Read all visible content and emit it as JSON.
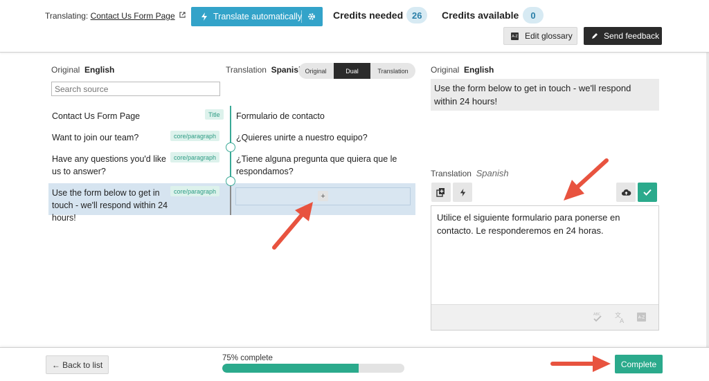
{
  "header": {
    "translating_label": "Translating:",
    "page_name": "Contact Us Form Page",
    "translate_button": "Translate automatically",
    "credits_needed_label": "Credits needed",
    "credits_needed_value": "26",
    "credits_available_label": "Credits available",
    "credits_available_value": "0",
    "edit_glossary": "Edit glossary",
    "send_feedback": "Send feedback"
  },
  "left_panel": {
    "original_label": "Original",
    "original_lang": "English",
    "translation_label": "Translation",
    "translation_lang": "Spanish",
    "search_placeholder": "Search source",
    "view_toggle": [
      "Original",
      "Dual",
      "Translation"
    ],
    "active_view": "Dual",
    "rows": [
      {
        "source": "Contact Us Form Page",
        "tag": "Title",
        "translation": "Formulario de contacto"
      },
      {
        "source": "Want to join our team?",
        "tag": "core/paragraph",
        "translation": "¿Quieres unirte a nuestro equipo?"
      },
      {
        "source": "Have any questions you'd like us to answer?",
        "tag": "core/paragraph",
        "translation": "¿Tiene alguna pregunta que quiera que le respondamos?"
      },
      {
        "source": "Use the form below to get in touch - we'll respond within 24 hours!",
        "tag": "core/paragraph",
        "translation": ""
      }
    ],
    "add_button": "+"
  },
  "right_panel": {
    "original_label": "Original",
    "original_lang": "English",
    "original_text": "Use the form below to get in touch - we'll respond within 24 hours!",
    "translation_label": "Translation",
    "translation_lang": "Spanish",
    "translation_text": "Utilice el siguiente formulario para ponerse en contacto. Le responderemos en 24 horas."
  },
  "footer": {
    "back_button": "← Back to list",
    "progress_label": "75% complete",
    "progress_fraction": 0.75,
    "complete_button": "Complete"
  },
  "colors": {
    "accent_blue": "#33a3c9",
    "accent_green": "#2baa8c",
    "arrow_red": "#e8533f",
    "selected_row": "#d6e4f0"
  }
}
